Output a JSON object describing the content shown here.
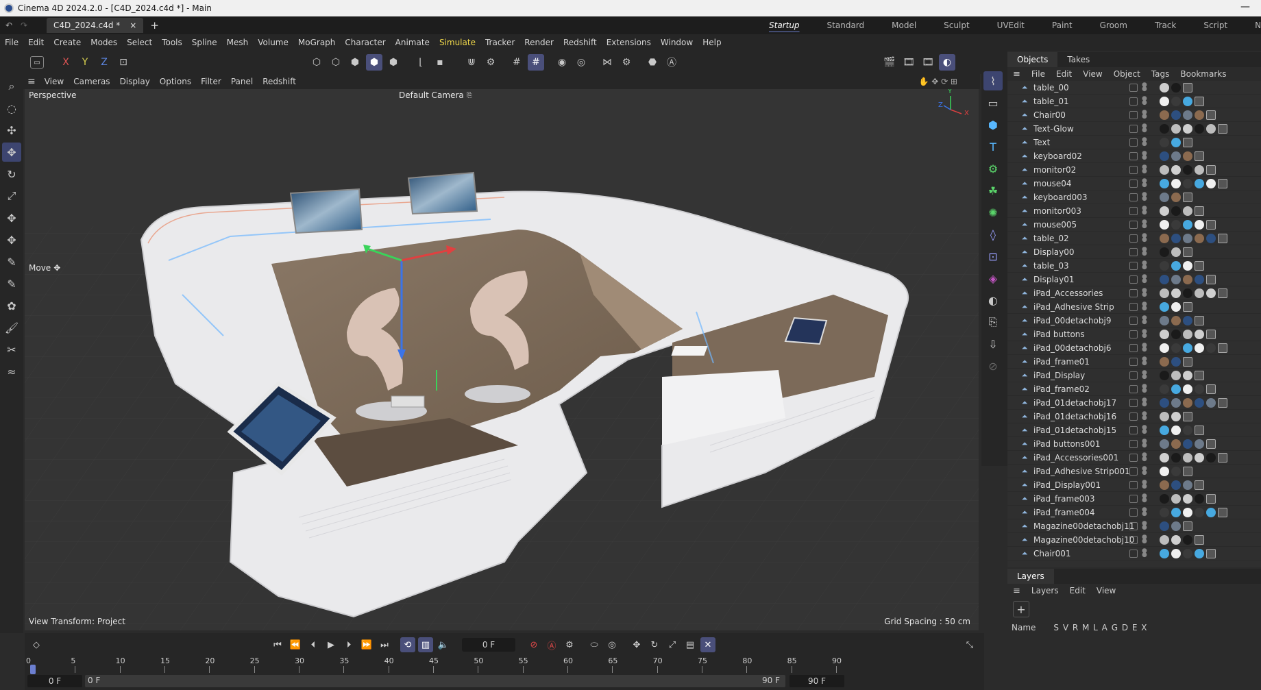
{
  "window": {
    "title": "Cinema 4D 2024.2.0 - [C4D_2024.c4d *] - Main",
    "minimize": "—"
  },
  "tabs": {
    "document": "C4D_2024.c4d *",
    "close": "×",
    "add": "+"
  },
  "layouts": [
    "Startup",
    "Standard",
    "Model",
    "Sculpt",
    "UVEdit",
    "Paint",
    "Groom",
    "Track",
    "Script",
    "Nodes"
  ],
  "menu": [
    "File",
    "Edit",
    "Create",
    "Modes",
    "Select",
    "Tools",
    "Spline",
    "Mesh",
    "Volume",
    "MoGraph",
    "Character",
    "Animate",
    "Simulate",
    "Tracker",
    "Render",
    "Redshift",
    "Extensions",
    "Window",
    "Help"
  ],
  "toolbar": {
    "x": "X",
    "y": "Y",
    "z": "Z"
  },
  "viewport_menu": [
    "View",
    "Cameras",
    "Display",
    "Options",
    "Filter",
    "Panel",
    "Redshift"
  ],
  "viewport": {
    "label": "Perspective",
    "camera": "Default Camera",
    "tool": "Move",
    "view_transform": "View Transform: Project",
    "grid_spacing": "Grid Spacing : 50 cm",
    "axis_x": "X",
    "axis_y": "Y",
    "axis_z": "Z"
  },
  "objects_panel": {
    "tabs": [
      "Objects",
      "Takes"
    ],
    "menu": [
      "File",
      "Edit",
      "View",
      "Object",
      "Tags",
      "Bookmarks"
    ],
    "items": [
      "table_00",
      "table_01",
      "Chair00",
      "Text-Glow",
      "Text",
      "keyboard02",
      "monitor02",
      "mouse04",
      "keyboard003",
      "monitor003",
      "mouse005",
      "table_02",
      "Display00",
      "table_03",
      "Display01",
      "iPad_Accessories",
      "iPad_Adhesive Strip",
      "iPad_00detachobj9",
      "iPad buttons",
      "iPad_00detachobj6",
      "iPad_frame01",
      "iPad_Display",
      "iPad_frame02",
      "iPad_01detachobj17",
      "iPad_01detachobj16",
      "iPad_01detachobj15",
      "iPad buttons001",
      "iPad_Accessories001",
      "iPad_Adhesive Strip001",
      "iPad_Display001",
      "iPad_frame003",
      "iPad_frame004",
      "Magazine00detachobj11",
      "Magazine00detachobj10",
      "Chair001"
    ]
  },
  "layers_panel": {
    "title": "Layers",
    "menu": [
      "Layers",
      "Edit",
      "View"
    ],
    "add": "+",
    "col_name": "Name",
    "col_flags": "S V R M L A G D E X"
  },
  "timeline": {
    "current_frame": "0 F",
    "ticks": [
      "0",
      "5",
      "10",
      "15",
      "20",
      "25",
      "30",
      "35",
      "40",
      "45",
      "50",
      "55",
      "60",
      "65",
      "70",
      "75",
      "80",
      "85",
      "90"
    ],
    "start": "0 F",
    "start2": "0 F",
    "end": "90 F",
    "end2": "90 F"
  },
  "colors": {
    "accent": "#4a4f7a",
    "highlight_menu": "#f1d94a",
    "viewport_bg": "#343434"
  }
}
